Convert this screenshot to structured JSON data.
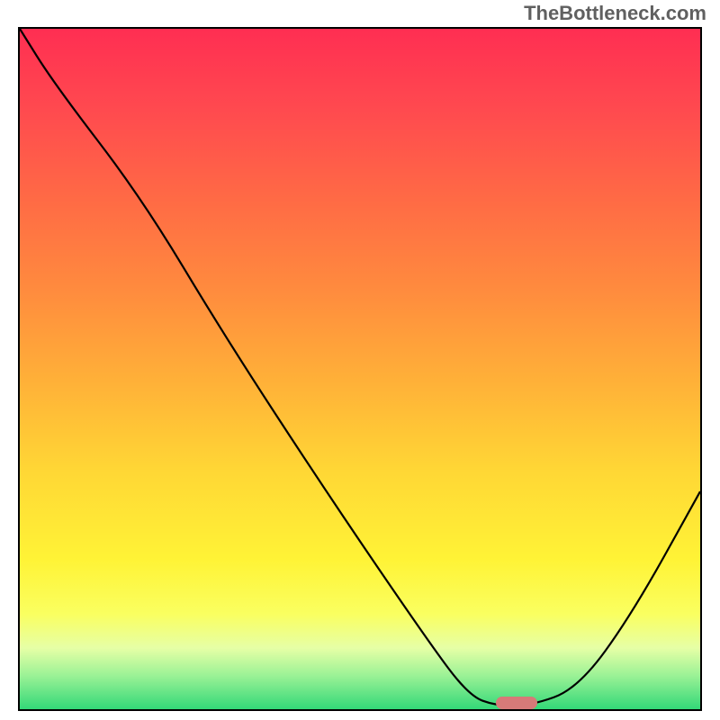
{
  "watermark": "TheBottleneck.com",
  "chart_data": {
    "type": "line",
    "title": "",
    "xlabel": "",
    "ylabel": "",
    "xlim": [
      0,
      100
    ],
    "ylim": [
      0,
      100
    ],
    "series": [
      {
        "name": "curve",
        "x": [
          0,
          5,
          18,
          30,
          45,
          60,
          66,
          70,
          75,
          82,
          90,
          100
        ],
        "y": [
          100,
          92,
          75,
          55,
          32,
          10,
          2,
          0.5,
          0.5,
          3,
          14,
          32
        ]
      }
    ],
    "marker": {
      "x_start": 70,
      "x_end": 76,
      "y": 0.5
    },
    "background_gradient": {
      "top": "#ff2e52",
      "middle": "#ffd735",
      "bottom": "#33d878"
    }
  }
}
